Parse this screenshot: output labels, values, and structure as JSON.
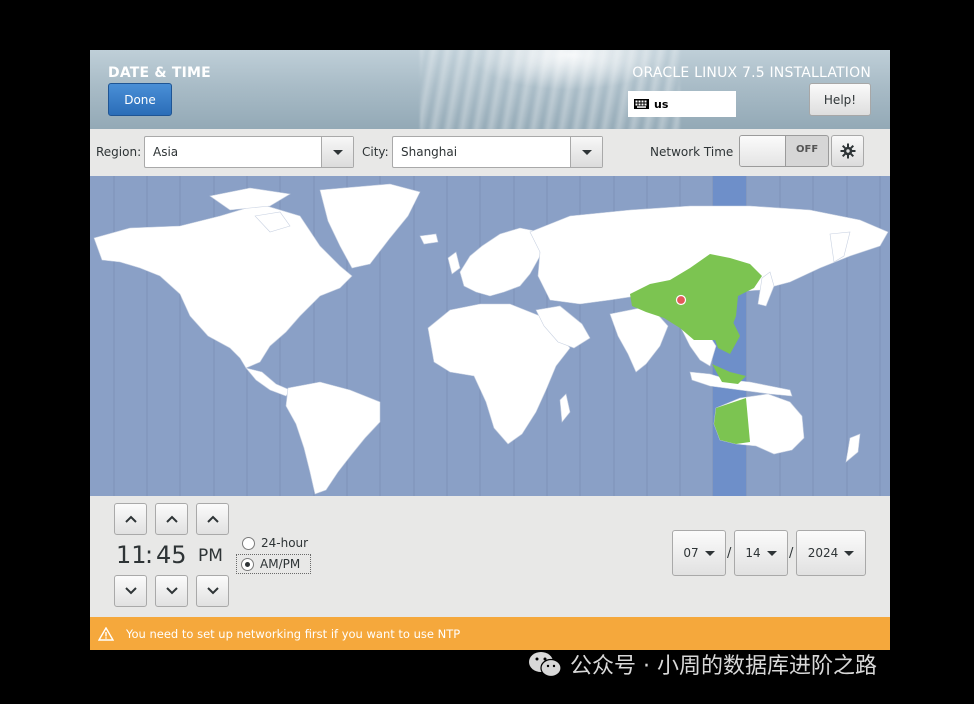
{
  "header": {
    "title": "DATE & TIME",
    "done_label": "Done",
    "product": "ORACLE LINUX 7.5 INSTALLATION",
    "keyboard_layout": "us",
    "help_label": "Help!"
  },
  "controls": {
    "region_label": "Region:",
    "region_value": "Asia",
    "city_label": "City:",
    "city_value": "Shanghai",
    "network_time_label": "Network Time",
    "network_time_state": "OFF"
  },
  "map": {
    "selected_zone_color": "#7cc451",
    "ocean_color": "#8aa0c6",
    "highlight_band_color": "#6e8fc9",
    "land_color": "#ffffff",
    "pin_color": "#e35a5a"
  },
  "time": {
    "hours": "11",
    "separator": ":",
    "minutes": "45",
    "period": "PM",
    "format_24": "24-hour",
    "format_ampm": "AM/PM",
    "selected_format": "AM/PM"
  },
  "date": {
    "month": "07",
    "day": "14",
    "year": "2024",
    "separator": "/"
  },
  "warning": {
    "message": "You need to set up networking first if you want to use NTP",
    "color": "#f5a83c"
  },
  "watermark": {
    "text": "公众号 · 小周的数据库进阶之路"
  }
}
